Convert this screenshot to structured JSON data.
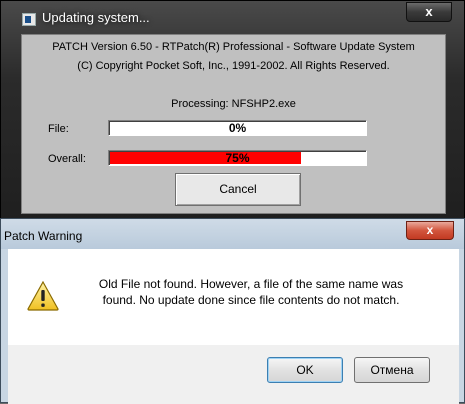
{
  "update_window": {
    "title": "Updating system...",
    "close_label": "x",
    "line1": "PATCH  Version 6.50 - RTPatch(R) Professional - Software Update System",
    "line2": "(C) Copyright Pocket Soft, Inc., 1991-2002.  All Rights Reserved.",
    "processing": "Processing: NFSHP2.exe",
    "file_label": "File:",
    "file_progress_text": "0%",
    "file_progress": 0.0,
    "overall_label": "Overall:",
    "overall_progress_text": "75%",
    "overall_progress": 0.75,
    "progress_color": "#ff0000",
    "cancel_label": "Cancel"
  },
  "warning_dialog": {
    "title": "Patch Warning",
    "close_label": "x",
    "icon": "warning-icon",
    "message_line1": "Old File not found. However, a file of the same name was",
    "message_line2": "found. No update done since file contents do not match.",
    "ok_label": "OK",
    "cancel_label": "Отмена"
  }
}
